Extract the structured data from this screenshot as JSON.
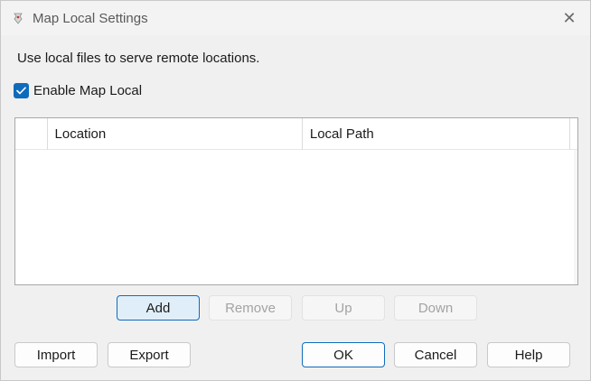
{
  "window": {
    "title": "Map Local Settings",
    "close_label": "✕"
  },
  "description": "Use local files to serve remote locations.",
  "enable": {
    "label": "Enable Map Local",
    "checked": true
  },
  "table": {
    "columns": [
      "",
      "Location",
      "Local Path"
    ],
    "rows": []
  },
  "row_buttons": {
    "add": "Add",
    "remove": "Remove",
    "up": "Up",
    "down": "Down"
  },
  "footer_buttons": {
    "import": "Import",
    "export": "Export",
    "ok": "OK",
    "cancel": "Cancel",
    "help": "Help"
  },
  "colors": {
    "accent": "#0f6cbd",
    "window_bg": "#f0f0f0"
  }
}
